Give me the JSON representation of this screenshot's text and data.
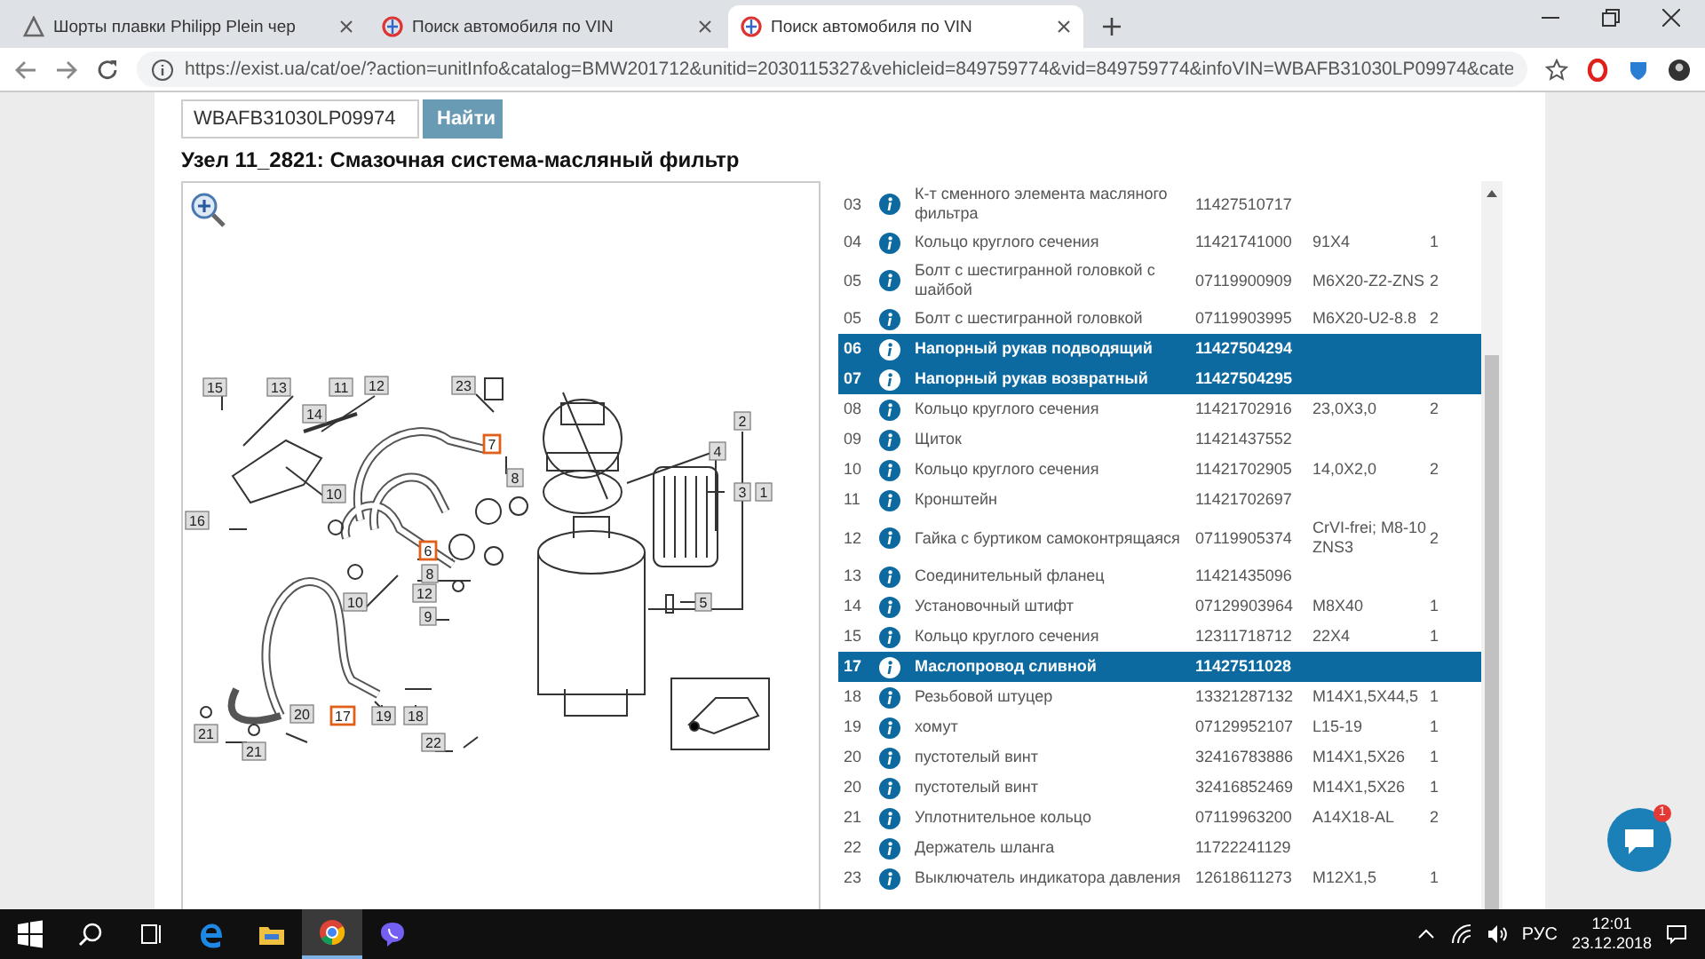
{
  "browser": {
    "tabs": [
      {
        "title": "Шорты плавки Philipp Plein чер",
        "selected": false
      },
      {
        "title": "Поиск автомобиля по VIN",
        "selected": false
      },
      {
        "title": "Поиск автомобиля по VIN",
        "selected": true
      }
    ],
    "url": "https://exist.ua/cat/oe/?action=unitInfo&catalog=BMW201712&unitid=2030115327&vehicleid=849759774&vid=849759774&infoVIN=WBAFB31030LP09974&cate"
  },
  "search": {
    "value": "WBAFB31030LP09974",
    "button": "Найти"
  },
  "unit_title": "Узел 11_2821: Смазочная система-масляный фильтр",
  "diagram": {
    "callouts": [
      {
        "label": "15",
        "selected": false
      },
      {
        "label": "13",
        "selected": false
      },
      {
        "label": "11",
        "selected": false
      },
      {
        "label": "12",
        "selected": false
      },
      {
        "label": "14",
        "selected": false
      },
      {
        "label": "23",
        "selected": false
      },
      {
        "label": "2",
        "selected": false
      },
      {
        "label": "4",
        "selected": false
      },
      {
        "label": "3",
        "selected": false
      },
      {
        "label": "1",
        "selected": false
      },
      {
        "label": "7",
        "selected": true
      },
      {
        "label": "8",
        "selected": false
      },
      {
        "label": "10",
        "selected": false
      },
      {
        "label": "16",
        "selected": false
      },
      {
        "label": "6",
        "selected": true
      },
      {
        "label": "8",
        "selected": false
      },
      {
        "label": "12",
        "selected": false
      },
      {
        "label": "9",
        "selected": false
      },
      {
        "label": "10",
        "selected": false
      },
      {
        "label": "5",
        "selected": false
      },
      {
        "label": "20",
        "selected": false
      },
      {
        "label": "21",
        "selected": false
      },
      {
        "label": "17",
        "selected": true
      },
      {
        "label": "19",
        "selected": false
      },
      {
        "label": "18",
        "selected": false
      },
      {
        "label": "21",
        "selected": false
      },
      {
        "label": "22",
        "selected": false
      }
    ]
  },
  "parts": [
    {
      "num": "03",
      "name": "К-т сменного элемента масляного фильтра",
      "part": "11427510717",
      "selected": false
    },
    {
      "num": "04",
      "name": "Кольцо круглого сечения",
      "part": "11421741000",
      "spec": "91X4",
      "qty": "1",
      "selected": false
    },
    {
      "num": "05",
      "name": "Болт с шестигранной головкой с шайбой",
      "part": "07119900909",
      "spec": "M6X20-Z2-ZNS",
      "qty": "2",
      "selected": false
    },
    {
      "num": "05",
      "name": "Болт с шестигранной головкой",
      "part": "07119903995",
      "spec": "M6X20-U2-8.8",
      "qty": "2",
      "selected": false
    },
    {
      "num": "06",
      "name": "Напорный рукав подводящий",
      "part": "11427504294",
      "selected": true
    },
    {
      "num": "07",
      "name": "Напорный рукав возвратный",
      "part": "11427504295",
      "selected": true
    },
    {
      "num": "08",
      "name": "Кольцо круглого сечения",
      "part": "11421702916",
      "spec": "23,0X3,0",
      "qty": "2",
      "selected": false
    },
    {
      "num": "09",
      "name": "Щиток",
      "part": "11421437552",
      "selected": false
    },
    {
      "num": "10",
      "name": "Кольцо круглого сечения",
      "part": "11421702905",
      "spec": "14,0X2,0",
      "qty": "2",
      "selected": false
    },
    {
      "num": "11",
      "name": "Кронштейн",
      "part": "11421702697",
      "selected": false
    },
    {
      "num": "12",
      "name": "Гайка с буртиком самоконтрящаяся",
      "part": "07119905374",
      "spec": "CrVI-frei; M8-10 ZNS3",
      "qty": "2",
      "selected": false
    },
    {
      "num": "13",
      "name": "Соединительный фланец",
      "part": "11421435096",
      "selected": false
    },
    {
      "num": "14",
      "name": "Установочный штифт",
      "part": "07129903964",
      "spec": "M8X40",
      "qty": "1",
      "selected": false
    },
    {
      "num": "15",
      "name": "Кольцо круглого сечения",
      "part": "12311718712",
      "spec": "22X4",
      "qty": "1",
      "selected": false
    },
    {
      "num": "17",
      "name": "Маслопровод сливной",
      "part": "11427511028",
      "selected": true
    },
    {
      "num": "18",
      "name": "Резьбовой штуцер",
      "part": "13321287132",
      "spec": "M14X1,5X44,5",
      "qty": "1",
      "selected": false
    },
    {
      "num": "19",
      "name": "хомут",
      "part": "07129952107",
      "spec": "L15-19",
      "qty": "1",
      "selected": false
    },
    {
      "num": "20",
      "name": "пустотелый винт",
      "part": "32416783886",
      "spec": "M14X1,5X26",
      "qty": "1",
      "selected": false
    },
    {
      "num": "20",
      "name": "пустотелый винт",
      "part": "32416852469",
      "spec": "M14X1,5X26",
      "qty": "1",
      "selected": false
    },
    {
      "num": "21",
      "name": "Уплотнительное кольцо",
      "part": "07119963200",
      "spec": "A14X18-AL",
      "qty": "2",
      "selected": false
    },
    {
      "num": "22",
      "name": "Держатель шланга",
      "part": "11722241129",
      "selected": false
    },
    {
      "num": "23",
      "name": "Выключатель индикатора давления",
      "part": "12618611273",
      "spec": "M12X1,5",
      "qty": "1",
      "selected": false
    }
  ],
  "chat": {
    "badge": "1"
  },
  "taskbar": {
    "language": "РУС",
    "time": "12:01",
    "date": "23.12.2018"
  }
}
